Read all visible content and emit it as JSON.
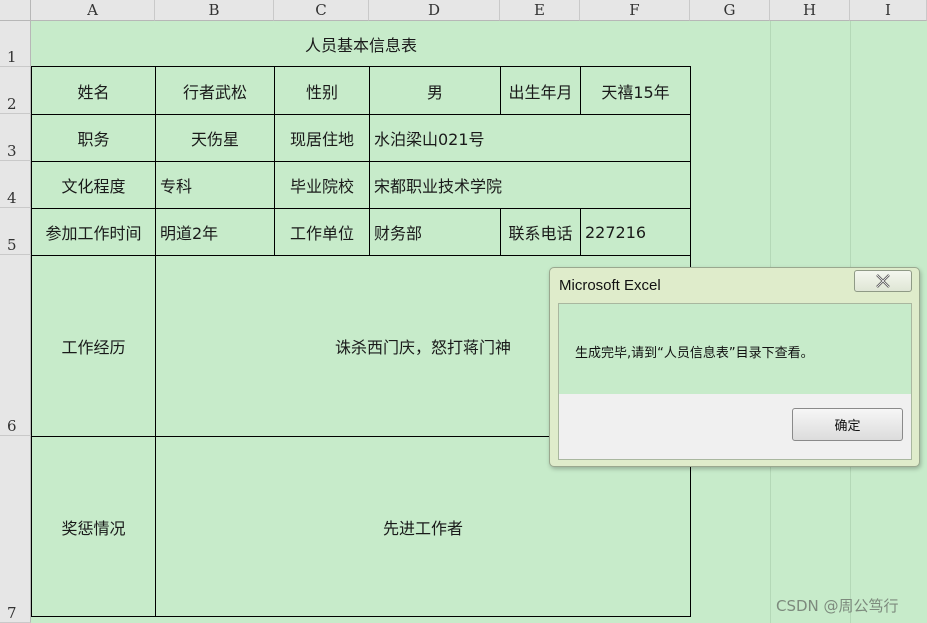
{
  "columns": [
    "A",
    "B",
    "C",
    "D",
    "E",
    "F",
    "G",
    "H",
    "I"
  ],
  "rows": [
    "1",
    "2",
    "3",
    "4",
    "5",
    "6",
    "7"
  ],
  "sheet": {
    "title": "人员基本信息表",
    "r2": {
      "name_label": "姓名",
      "name": "行者武松",
      "gender_label": "性别",
      "gender": "男",
      "birth_label": "出生年月",
      "birth": "天禧15年"
    },
    "r3": {
      "position_label": "职务",
      "position": "天伤星",
      "address_label": "现居住地",
      "address": "水泊梁山021号"
    },
    "r4": {
      "education_label": "文化程度",
      "education": "专科",
      "school_label": "毕业院校",
      "school": "宋都职业技术学院"
    },
    "r5": {
      "start_label": "参加工作时间",
      "start": "明道2年",
      "unit_label": "工作单位",
      "unit": "财务部",
      "phone_label": "联系电话",
      "phone": "227216"
    },
    "r6": {
      "experience_label": "工作经历",
      "experience": "诛杀西门庆，怒打蒋门神"
    },
    "r7": {
      "award_label": "奖惩情况",
      "award": "先进工作者"
    }
  },
  "dialog": {
    "title": "Microsoft Excel",
    "close_icon": "close-x-icon",
    "message": "生成完毕,请到“人员信息表”目录下查看。",
    "ok_label": "确定"
  },
  "watermark": "CSDN @周公笃行",
  "colors": {
    "sheet_bg": "#c7ebca",
    "header_bg": "#e6e6e6",
    "dialog_bg": "#dfeccb"
  }
}
